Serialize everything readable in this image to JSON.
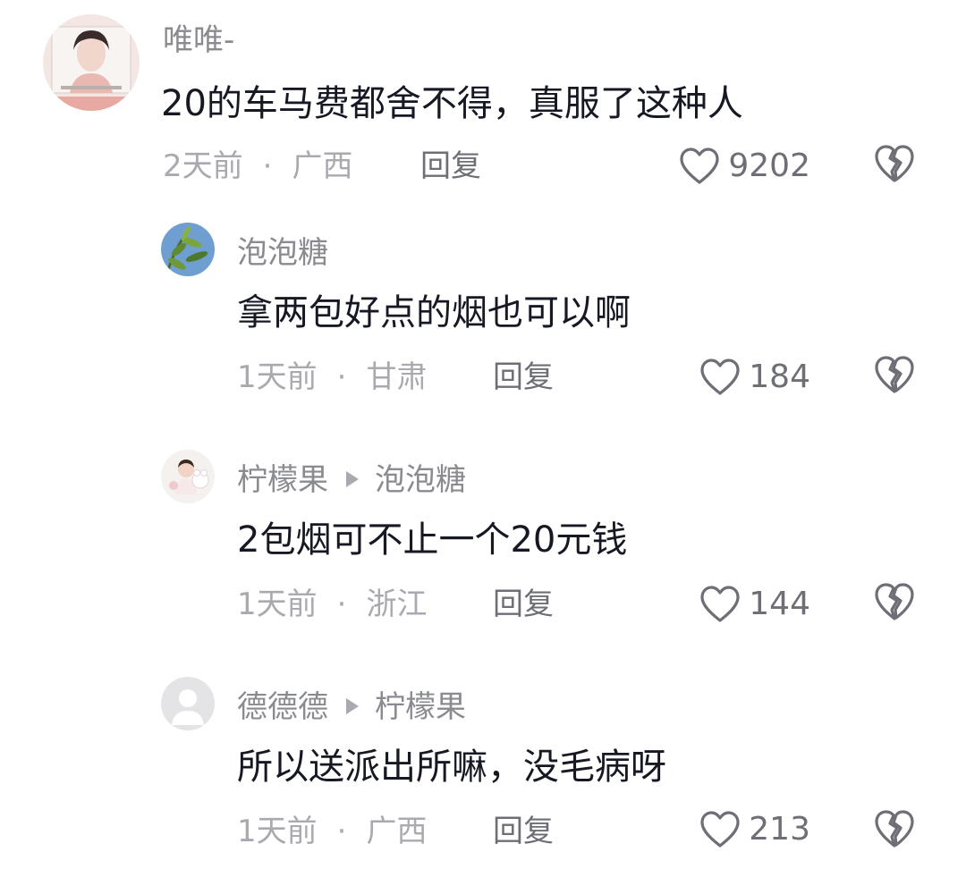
{
  "comments": [
    {
      "username": "唯唯-",
      "text": "20的车马费都舍不得，真服了这种人",
      "time": "2天前",
      "location": "广西",
      "reply_label": "回复",
      "likes": "9202"
    },
    {
      "username": "泡泡糖",
      "text": "拿两包好点的烟也可以啊",
      "time": "1天前",
      "location": "甘肃",
      "reply_label": "回复",
      "likes": "184"
    },
    {
      "username": "柠檬果",
      "reply_to": "泡泡糖",
      "text": "2包烟可不止一个20元钱",
      "time": "1天前",
      "location": "浙江",
      "reply_label": "回复",
      "likes": "144"
    },
    {
      "username": "德德德",
      "reply_to": "柠檬果",
      "text": "所以送派出所嘛，没毛病呀",
      "time": "1天前",
      "location": "广西",
      "reply_label": "回复",
      "likes": "213"
    }
  ],
  "meta_separator": "·",
  "colors": {
    "text_primary": "#161823",
    "text_secondary": "#8a8b91",
    "text_muted": "#a9aab0",
    "icon": "#6e6f76",
    "background": "#ffffff"
  },
  "icons": {
    "like": "heart-outline-icon",
    "dislike": "broken-heart-icon",
    "reply_arrow": "triangle-right-icon"
  }
}
